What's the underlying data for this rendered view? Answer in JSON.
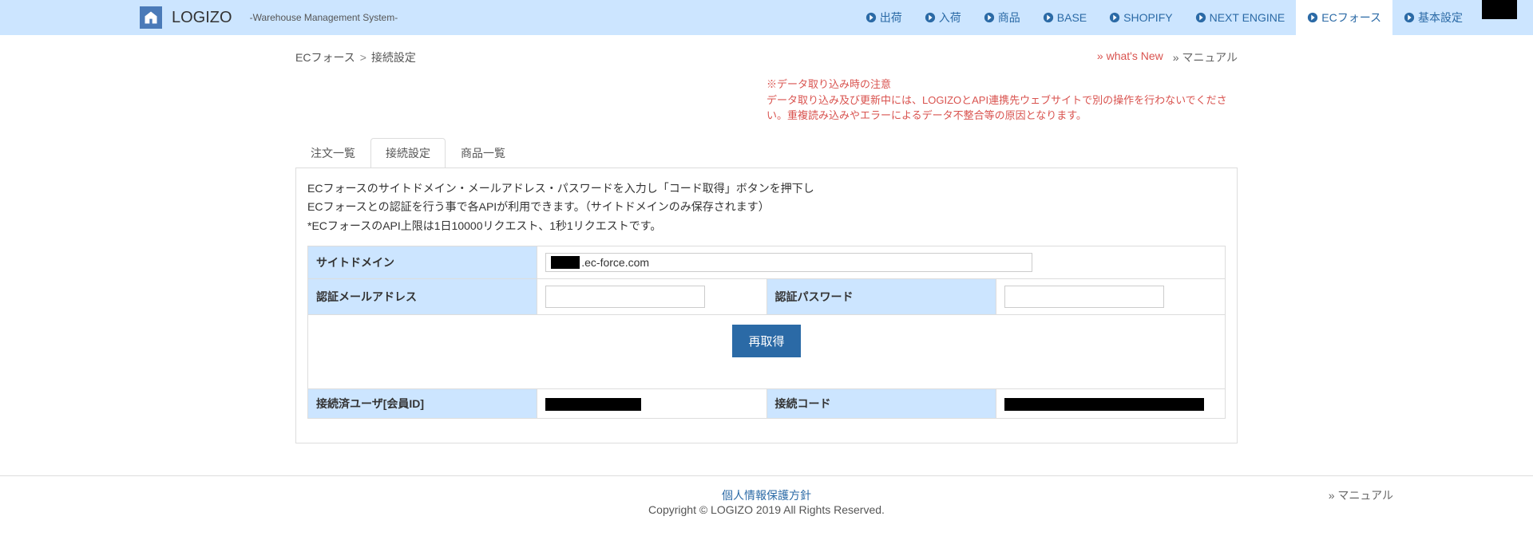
{
  "brand": {
    "name": "LOGIZO",
    "subtitle": "-Warehouse Management System-"
  },
  "nav": {
    "items": [
      {
        "label": "出荷"
      },
      {
        "label": "入荷"
      },
      {
        "label": "商品"
      },
      {
        "label": "BASE"
      },
      {
        "label": "SHOPIFY"
      },
      {
        "label": "NEXT ENGINE"
      },
      {
        "label": "ECフォース"
      },
      {
        "label": "基本設定"
      }
    ]
  },
  "breadcrumb": {
    "a": "ECフォース",
    "sep": ">",
    "b": "接続設定"
  },
  "links": {
    "whatsnew": "» what's New",
    "manual": "» マニュアル"
  },
  "notice": {
    "line1": "※データ取り込み時の注意",
    "line2": "データ取り込み及び更新中には、LOGIZOとAPI連携先ウェブサイトで別の操作を行わないでください。重複読み込みやエラーによるデータ不整合等の原因となります。"
  },
  "tabs": {
    "orders": "注文一覧",
    "conn": "接続設定",
    "products": "商品一覧"
  },
  "instr": {
    "l1": "ECフォースのサイトドメイン・メールアドレス・パスワードを入力し「コード取得」ボタンを押下し",
    "l2": "ECフォースとの認証を行う事で各APIが利用できます。（サイトドメインのみ保存されます）",
    "l3": "*ECフォースのAPI上限は1日10000リクエスト、1秒1リクエストです。"
  },
  "fields": {
    "domain_label": "サイトドメイン",
    "domain_suffix": ".ec-force.com",
    "email_label": "認証メールアドレス",
    "password_label": "認証パスワード",
    "connected_user_label": "接続済ユーザ[会員ID]",
    "conn_code_label": "接続コード"
  },
  "buttons": {
    "reacquire": "再取得"
  },
  "footer": {
    "privacy": "個人情報保護方針",
    "copyright": "Copyright © LOGIZO 2019 All Rights Reserved.",
    "manual": "» マニュアル"
  }
}
